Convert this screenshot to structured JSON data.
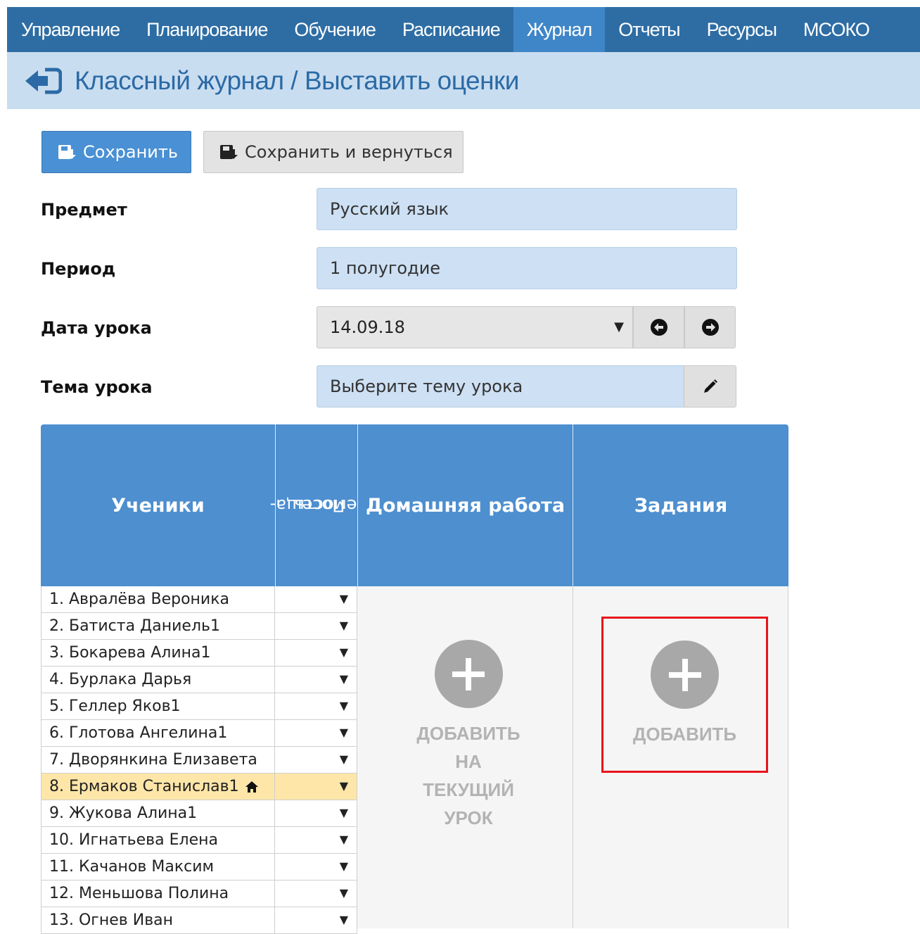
{
  "nav": {
    "items": [
      "Управление",
      "Планирование",
      "Обучение",
      "Расписание",
      "Журнал",
      "Отчеты",
      "Ресурсы",
      "МСОКО"
    ],
    "active_index": 4
  },
  "title": "Классный журнал / Выставить оценки",
  "buttons": {
    "save": "Сохранить",
    "save_return": "Сохранить и вернуться"
  },
  "form": {
    "subject_label": "Предмет",
    "subject_value": "Русский язык",
    "period_label": "Период",
    "period_value": "1 полугодие",
    "date_label": "Дата урока",
    "date_value": "14.09.18",
    "theme_label": "Тема урока",
    "theme_value": "Выберите тему урока"
  },
  "table": {
    "headers": {
      "students": "Ученики",
      "attendance_line1": "Посеща-",
      "attendance_line2": "емость",
      "homework": "Домашняя работа",
      "tasks": "Задания"
    },
    "students": [
      "1. Авралёва Вероника",
      "2. Батиста Даниель1",
      "3. Бокарева Алина1",
      "4. Бурлака Дарья",
      "5. Геллер Яков1",
      "6. Глотова Ангелина1",
      "7. Дворянкина Елизавета",
      "8. Ермаков Станислав1",
      "9. Жукова Алина1",
      "10. Игнатьева Елена",
      "11. Качанов Максим",
      "12. Меньшова Полина",
      "13. Огнев Иван"
    ],
    "highlighted_index": 7,
    "homework_add": [
      "ДОБАВИТЬ",
      "НА",
      "ТЕКУЩИЙ",
      "УРОК"
    ],
    "tasks_add": "ДОБАВИТЬ"
  },
  "colors": {
    "nav_bg": "#2e6da4",
    "nav_active": "#3f86c8",
    "title_bg": "#c9ddf0",
    "header_bg": "#4d8fcf",
    "highlight_row": "#fde6a8",
    "highlight_box": "#e8141b"
  }
}
